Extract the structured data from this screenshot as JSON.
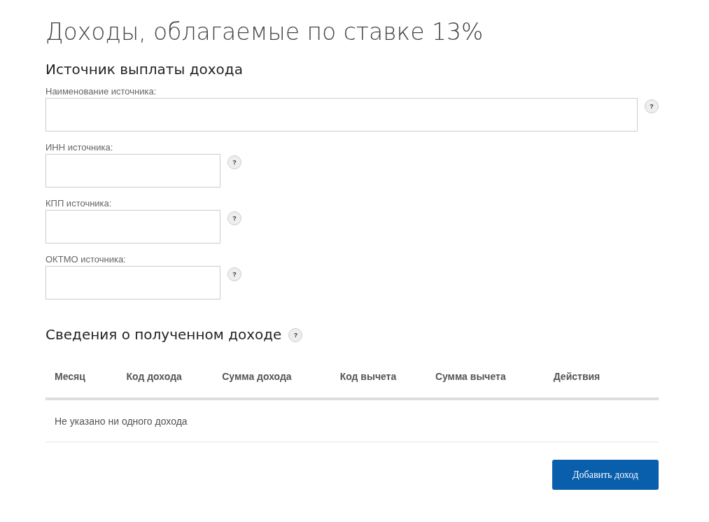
{
  "title": "Доходы, облагаемые по ставке 13%",
  "source_section": {
    "heading": "Источник выплаты дохода",
    "fields": [
      {
        "kind": "wide",
        "label": "Наименование источника:",
        "help": "?"
      },
      {
        "kind": "narrow",
        "label": "ИНН источника:",
        "help": "?"
      },
      {
        "kind": "narrow",
        "label": "КПП источника:",
        "help": "?"
      },
      {
        "kind": "narrow",
        "label": "ОКТМО источника:",
        "help": "?"
      }
    ]
  },
  "income_section": {
    "heading": "Сведения о полученном доходе",
    "help": "?",
    "table": {
      "columns": [
        "Месяц",
        "Код дохода",
        "Сумма дохода",
        "Код вычета",
        "Сумма вычета",
        "Действия"
      ],
      "empty_message": "Не указано ни одного дохода"
    },
    "add_button": "Добавить доход"
  }
}
